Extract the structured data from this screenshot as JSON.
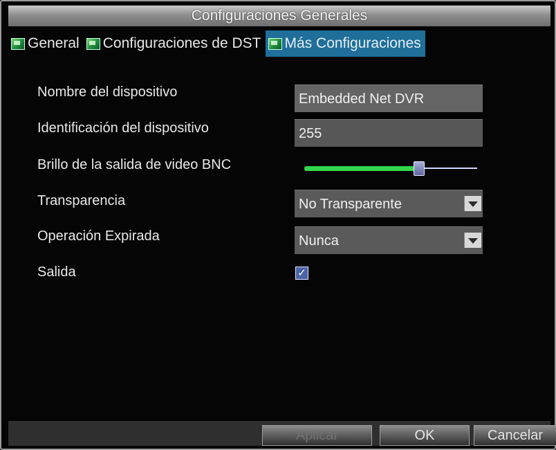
{
  "window": {
    "title": "Configuraciones Generales"
  },
  "tabs": [
    {
      "label": "General"
    },
    {
      "label": "Configuraciones de DST"
    },
    {
      "label": "Más Configuraciones"
    }
  ],
  "form": {
    "device_name": {
      "label": "Nombre del dispositivo",
      "value": "Embedded Net DVR"
    },
    "device_id": {
      "label": "Identificación del dispositivo",
      "value": "255"
    },
    "brightness": {
      "label": "Brillo de la salida de video BNC",
      "level_percent": 65
    },
    "transparency": {
      "label": "Transparencia",
      "value": "No Transparente"
    },
    "timeout": {
      "label": "Operación Expirada",
      "value": "Nunca"
    },
    "exit": {
      "label": "Salida",
      "checked": true
    }
  },
  "buttons": {
    "apply": "Aplicar",
    "ok": "OK",
    "cancel": "Cancelar"
  },
  "icons": {
    "tab_icon": "picture-icon",
    "checkbox": "checkmark-icon",
    "dropdown": "chevron-down-icon"
  },
  "colors": {
    "active_tab": "#1f6f9a",
    "slider_fill": "#32d64b",
    "checkbox": "#4a63a8"
  }
}
